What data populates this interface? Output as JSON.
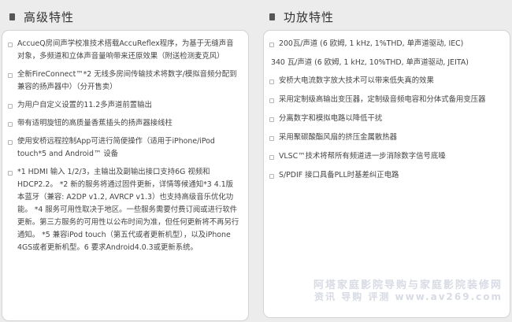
{
  "left": {
    "title": "高级特性",
    "items": [
      "AccueQ房间声学校准技术搭载AccuReflex程序，为基于无缝声音对象，多频道和立体声音量响带来还原效果（附送检测麦克风）",
      "全新FireConnect™*2 无线多房间传输技术将数字/模拟音频分配到兼容的扬声器中）（分开售卖）",
      "为用户自定义设置的11.2多声道前置输出",
      "带有适明旋钮的高质量香蕉插头的扬声器接线柱",
      "使用安桥远程控制App可进行简便操作（适用于iPhone/iPod touch*5 and Android™ 设备",
      "*1 HDMI 输入 1/2/3，主输出及副输出接口支持6G 视频和HDCP2.2。 *2 新的服务将通过固件更新，详情等候通知*3 4.1版本蓝牙（兼容: A2DP v1.2, AVRCP v1.3）也支持高级音乐优化功能。 *4 服务可用性取决于地区。一些服务需要付费订阅或进行软件更新。第三方服务的可用性以公布时间为准，但任何更新将不再另行通知。 *5 兼容iPod touch（第五代或者更新机型），以及iPhone 4GS或者更新机型。6 要求Android4.0.3或更新系统。"
    ]
  },
  "right": {
    "title": "功放特性",
    "items": [
      {
        "text": "200瓦/声道 (6 欧姆, 1 kHz, 1%THD, 单声道驱动, IEC)",
        "bullet": true
      },
      {
        "text": "340 瓦/声道 (6 欧姆, 1 kHz, 10%THD, 单声道驱动, JEITA)",
        "bullet": false
      },
      {
        "text": "安桥大电流数字放大技术可以带来低失真的效果",
        "bullet": true
      },
      {
        "text": "采用定制级高输出变压器，定制级音频电容和分体式备用变压器",
        "bullet": true
      },
      {
        "text": "分离数字和模拟电路以降低干扰",
        "bullet": true
      },
      {
        "text": "采用聚碳酸酯风扇的挤压金属散热器",
        "bullet": true
      },
      {
        "text": "VLSC™技术将帮所有频道进一步消除数字信号底噪",
        "bullet": true
      },
      {
        "text": "S/PDIF 接口具备PLL时基差纠正电路",
        "bullet": true
      }
    ]
  },
  "watermark": {
    "line1": "阿塔家庭影院导购与家庭影院装修网",
    "line2": "资讯 导购 评测 www.av269.com"
  }
}
